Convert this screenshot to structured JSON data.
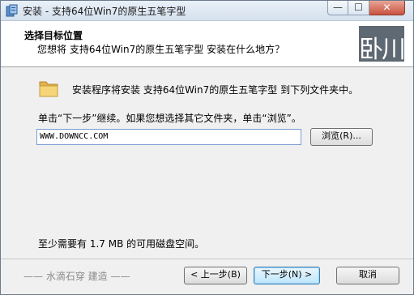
{
  "window": {
    "title": "安装 - 支持64位Win7的原生五笔字型",
    "controls": {
      "minimize": "—",
      "maximize": "☐",
      "close": "✕"
    }
  },
  "header": {
    "title": "选择目标位置",
    "subtitle": "您想将 支持64位Win7的原生五笔字型 安装在什么地方？",
    "logo_text": "卧川"
  },
  "body": {
    "install_text": "安装程序将安装 支持64位Win7的原生五笔字型 到下列文件夹中。",
    "instruction": "单击“下一步”继续。如果您想选择其它文件夹，单击“浏览”。",
    "path_value": "WWW.DOWNCC.COM",
    "browse_label": "浏览(R)...",
    "space_text": "至少需要有 1.7 MB 的可用磁盘空间。"
  },
  "footer": {
    "branding": "—— 水滴石穿 建造 ——",
    "back_label": "< 上一步(B)",
    "next_label": "下一步(N) >",
    "cancel_label": "取消"
  },
  "icons": {
    "app": "installer-icon",
    "folder": "folder-icon"
  },
  "colors": {
    "folder": "#f2c760",
    "logo_bg": "#5f6973",
    "accent_border": "#3c7fb1"
  }
}
